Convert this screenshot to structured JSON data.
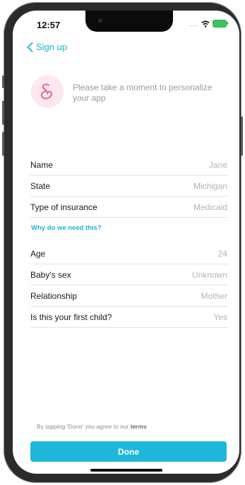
{
  "status_bar": {
    "time": "12:57",
    "signal": "....",
    "colors": {
      "battery": "#3cc35a"
    }
  },
  "nav": {
    "back_label": "Sign up"
  },
  "hero": {
    "text": "Please take a moment to personalize your app",
    "icon": "pregnancy-icon"
  },
  "form_top": [
    {
      "label": "Name",
      "value": "Jane"
    },
    {
      "label": "State",
      "value": "Michigan"
    },
    {
      "label": "Type of insurance",
      "value": "Medicaid"
    }
  ],
  "why_link": "Why do we need this?",
  "form_bottom": [
    {
      "label": "Age",
      "value": "24"
    },
    {
      "label": "Baby's sex",
      "value": "Unknown"
    },
    {
      "label": "Relationship",
      "value": "Mother"
    },
    {
      "label": "Is this your first child?",
      "value": "Yes"
    }
  ],
  "terms": {
    "prefix": "By tapping 'Done' you agree to our",
    "link": "terms"
  },
  "done_label": "Done",
  "colors": {
    "accent": "#1fb1d6",
    "hero_bg": "#fde8ef",
    "hero_icon": "#e8678f"
  }
}
